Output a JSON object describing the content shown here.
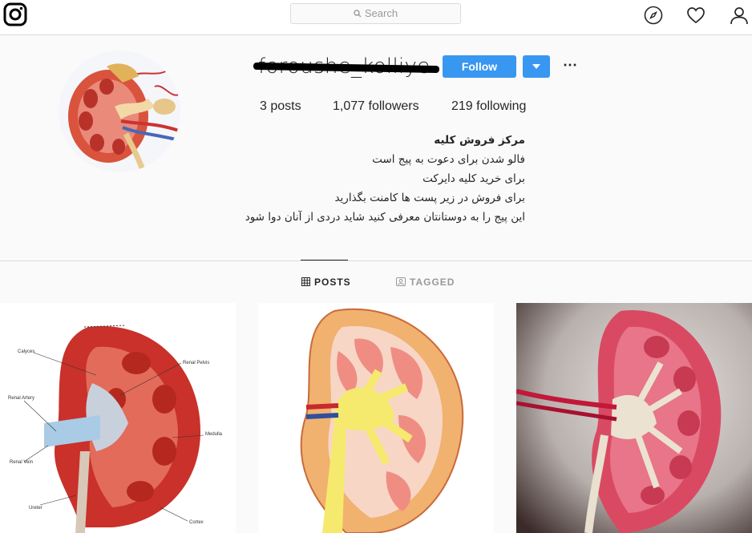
{
  "topbar": {
    "logo": "instagram-logo",
    "search_placeholder": "Search",
    "icons": [
      "compass-icon",
      "heart-icon",
      "user-icon"
    ]
  },
  "profile": {
    "username": "foroushe_kolliye",
    "follow_label": "Follow",
    "stats": {
      "posts_count": "3",
      "posts_label": "posts",
      "followers_count": "1,077",
      "followers_label": "followers",
      "following_count": "219",
      "following_label": "following"
    },
    "bio": {
      "name": "مرکز فروش کلیه",
      "lines": [
        "فالو شدن برای دعوت به پیج است",
        "برای خرید کلیه دایرکت",
        "برای فروش در زیر پست ها کامنت بگذارید",
        "این پیج را به دوستانتان معرفی کنید شاید دردی از آنان دوا شود"
      ]
    }
  },
  "tabs": {
    "posts": "POSTS",
    "tagged": "TAGGED"
  },
  "posts": {
    "post1_labels": [
      "Calyces",
      "Renal Pelvis",
      "Renal Artery",
      "Medulla",
      "Renal Vein",
      "Ureter",
      "Cortex"
    ]
  },
  "colors": {
    "accent": "#3897f0",
    "border": "#dbdbdb",
    "background": "#fafafa"
  }
}
